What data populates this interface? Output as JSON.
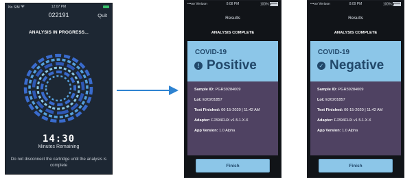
{
  "colors": {
    "result_panel": "#8cc6e8",
    "result_text": "#21486a",
    "details_panel": "#4f4262",
    "screen_bg": "#111418",
    "analysis_bg": "#1d2733",
    "arrow": "#2e83d1",
    "battery_green": "#39c06a"
  },
  "analysis_screen": {
    "status_left": "No SIM",
    "time": "12:07 PM",
    "header_id": "022191",
    "quit": "Quit",
    "title": "ANALYSIS IN PROGRESS...",
    "timer": "14:30",
    "timer_caption": "Minutes Remaining",
    "warning": "Do not disconnect the cartridge until the analysis is complete",
    "icons": [
      "wifi-icon",
      "battery-icon",
      "progress-ring-icon"
    ]
  },
  "results": [
    {
      "carrier": "•••oo Verizon",
      "time": "8:08 PM",
      "battery": "100%",
      "title": "Results",
      "header": "ANALYSIS COMPLETE",
      "test": "COVID-19",
      "status": "Positive",
      "status_icon": "exclamation-circle-icon",
      "status_glyph": "!",
      "sample_label": "Sample ID:",
      "sample_value": "PGR39284009",
      "lot_label": "Lot:",
      "lot_value": "E20201857",
      "finished_label": "Test Finished:",
      "finished_value": "06-15-2020 | 11:42 AM",
      "adapter_label": "Adapter:",
      "adapter_value": "FJ394FHX v1.5.1.X.X",
      "app_label": "App Version:",
      "app_value": "1.0 Alpha",
      "finish": "Finish"
    },
    {
      "carrier": "•••oo Verizon",
      "time": "8:09 PM",
      "battery": "100%",
      "title": "Results",
      "header": "ANALYSIS COMPLETE",
      "test": "COVID-19",
      "status": "Negative",
      "status_icon": "check-circle-icon",
      "status_glyph": "✓",
      "sample_label": "Sample ID:",
      "sample_value": "PGR39284009",
      "lot_label": "Lot:",
      "lot_value": "E20201857",
      "finished_label": "Test Finished:",
      "finished_value": "06-15-2020 | 11:42 AM",
      "adapter_label": "Adapter:",
      "adapter_value": "FJ394FHX v1.5.1.X.X",
      "app_label": "App Version:",
      "app_value": "1.0 Alpha",
      "finish": "Finish"
    }
  ]
}
